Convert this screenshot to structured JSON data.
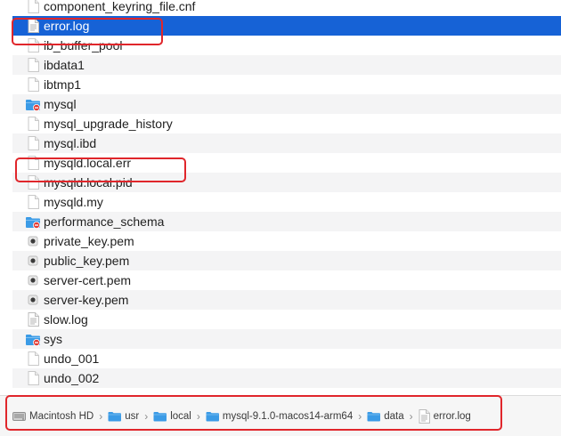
{
  "files": [
    {
      "name": "component_keyring_file.cnf",
      "icon": "document-icon",
      "selected": false
    },
    {
      "name": "error.log",
      "icon": "log-file-icon",
      "selected": true
    },
    {
      "name": "ib_buffer_pool",
      "icon": "document-icon",
      "selected": false
    },
    {
      "name": "ibdata1",
      "icon": "document-icon",
      "selected": false
    },
    {
      "name": "ibtmp1",
      "icon": "document-icon",
      "selected": false
    },
    {
      "name": "mysql",
      "icon": "restricted-folder-icon",
      "selected": false
    },
    {
      "name": "mysql_upgrade_history",
      "icon": "document-icon",
      "selected": false
    },
    {
      "name": "mysql.ibd",
      "icon": "document-icon",
      "selected": false
    },
    {
      "name": "mysqld.local.err",
      "icon": "document-icon",
      "selected": false
    },
    {
      "name": "mysqld.local.pid",
      "icon": "document-icon",
      "selected": false
    },
    {
      "name": "mysqld.my",
      "icon": "document-icon",
      "selected": false
    },
    {
      "name": "performance_schema",
      "icon": "restricted-folder-icon",
      "selected": false
    },
    {
      "name": "private_key.pem",
      "icon": "certificate-icon",
      "selected": false
    },
    {
      "name": "public_key.pem",
      "icon": "certificate-icon",
      "selected": false
    },
    {
      "name": "server-cert.pem",
      "icon": "certificate-icon",
      "selected": false
    },
    {
      "name": "server-key.pem",
      "icon": "certificate-icon",
      "selected": false
    },
    {
      "name": "slow.log",
      "icon": "log-file-icon",
      "selected": false
    },
    {
      "name": "sys",
      "icon": "restricted-folder-icon",
      "selected": false
    },
    {
      "name": "undo_001",
      "icon": "document-icon",
      "selected": false
    },
    {
      "name": "undo_002",
      "icon": "document-icon",
      "selected": false
    }
  ],
  "path_bar": [
    {
      "label": "Macintosh HD",
      "icon": "hard-drive-icon"
    },
    {
      "label": "usr",
      "icon": "folder-icon"
    },
    {
      "label": "local",
      "icon": "folder-icon"
    },
    {
      "label": "mysql-9.1.0-macos14-arm64",
      "icon": "folder-icon"
    },
    {
      "label": "data",
      "icon": "folder-icon"
    },
    {
      "label": "error.log",
      "icon": "log-file-icon"
    }
  ],
  "separator": "›",
  "colors": {
    "selection": "#1662d6",
    "highlight_box": "#e0262b",
    "folder": "#3b9be6"
  }
}
